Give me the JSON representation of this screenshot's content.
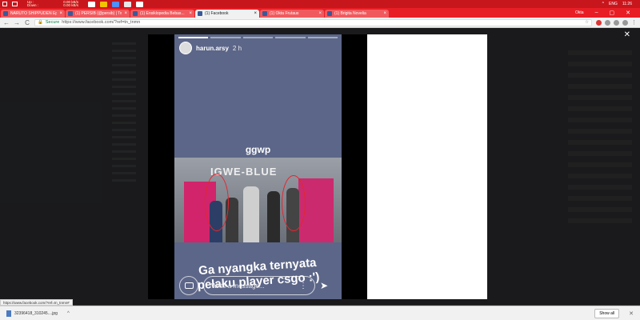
{
  "taskbar": {
    "speed_up_label": "Up :",
    "speed_up_value": "0.00 kB/s",
    "speed_down_label": "Down :",
    "speed_down_value": "0.00 kB/s",
    "app_colors": [
      "#ffffff",
      "#f3c300",
      "#4d90fe",
      "#e8e8e8",
      "#ffffff"
    ],
    "language": "ENG",
    "time": "11:26"
  },
  "tabs": [
    {
      "title": "NARUTO SHIPPUDEN Epi...",
      "active": false
    },
    {
      "title": "(1) PERSIB (@persib) | Tw...",
      "active": false
    },
    {
      "title": "(1) Ensiklopedia Bebas...",
      "active": false
    },
    {
      "title": "(1) Facebook",
      "active": true
    },
    {
      "title": "(1) Okta Frutaus",
      "active": false
    },
    {
      "title": "(1) Brigita Novelia",
      "active": false
    }
  ],
  "window": {
    "user": "Okta",
    "min": "–",
    "max": "▢",
    "close": "✕"
  },
  "address": {
    "back": "←",
    "forward": "→",
    "reload": "C",
    "secure_label": "Secure",
    "url": "https://www.facebook.com/?ref=tn_tnmn"
  },
  "story": {
    "username": "harun.arsy",
    "time": "2 h",
    "progress_total": 5,
    "progress_done": 1,
    "caption_top": "ggwp",
    "banner_text": "IGWE-BLUE",
    "caption_bottom_line1": "Ga nyangka ternyata",
    "caption_bottom_line2": "pelaku player csgo :')",
    "message_placeholder": "Write a message...",
    "more_icon": "⋮",
    "send_icon": "➤"
  },
  "overlay_close": "✕",
  "status_url": "https://www.facebook.com/?ref=tn_tnmn#",
  "download": {
    "file_name": "32396418_310245....jpg",
    "caret": "^",
    "show_all": "Show all",
    "close": "✕"
  }
}
